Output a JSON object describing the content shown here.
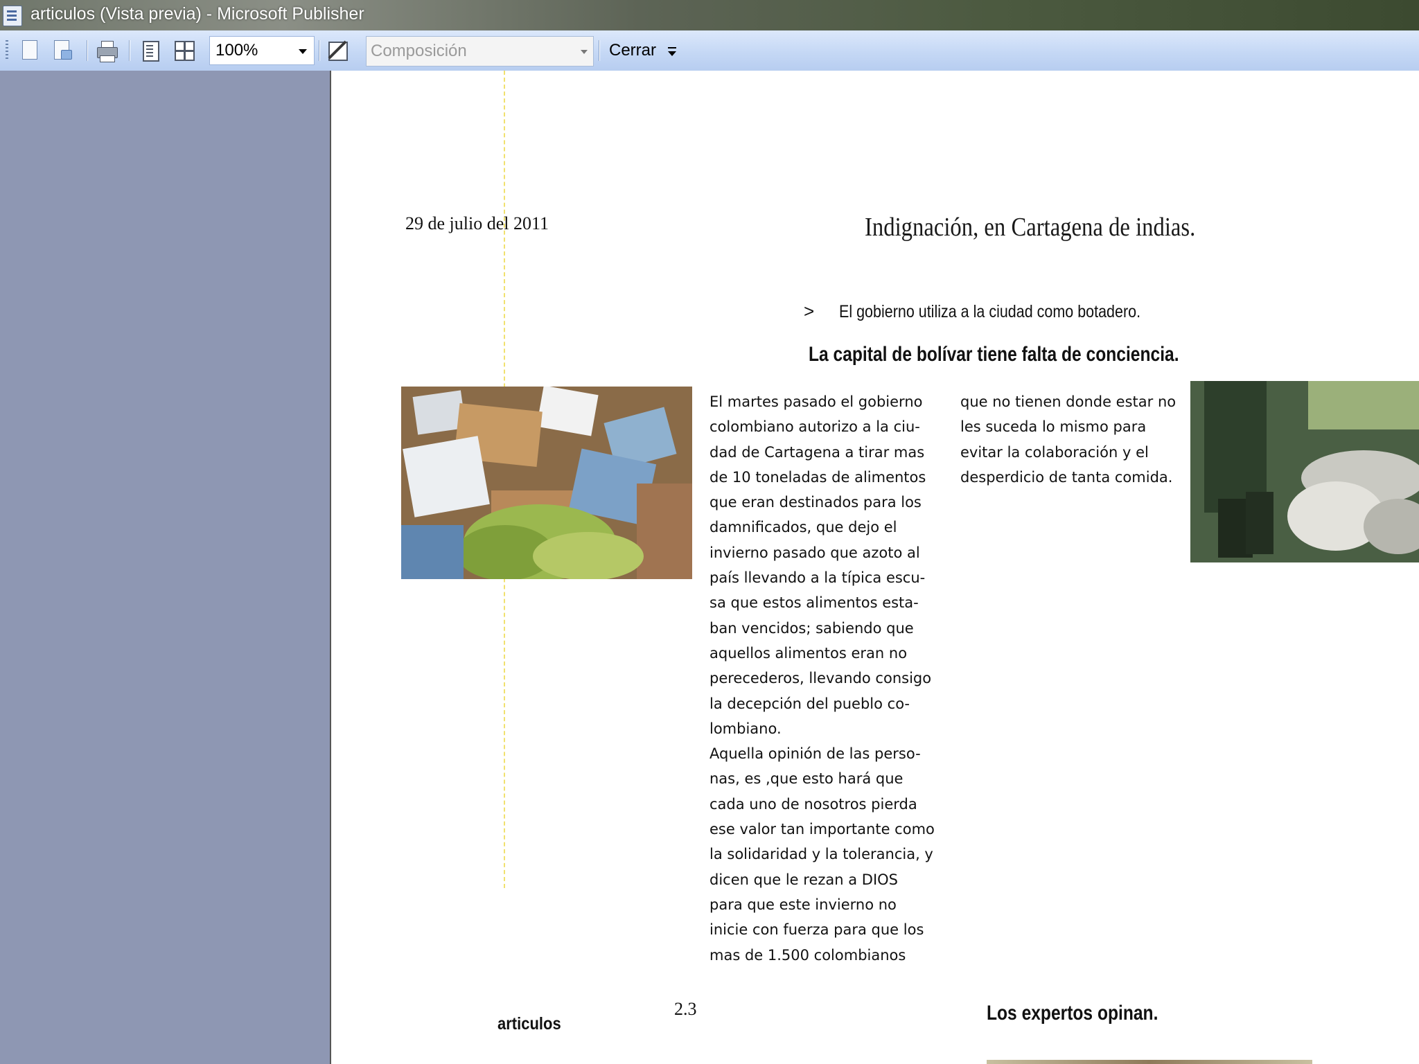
{
  "window": {
    "title": "articulos (Vista previa)  - Microsoft Publisher",
    "icon": "publisher-icon"
  },
  "toolbar": {
    "icons": [
      "page-setup-icon",
      "print-preview-icon",
      "print-icon",
      "one-page-icon",
      "multiple-pages-icon",
      "pen-icon"
    ],
    "zoom": "100%",
    "composition_placeholder": "Composición",
    "close_label": "Cerrar"
  },
  "document": {
    "date": "29 de julio del 2011",
    "headline": "Indignación, en Cartagena de indias.",
    "bullet_symbol": ">",
    "bullet_text": "El gobierno utiliza a la ciudad como botadero.",
    "subheadline": "La  capital de bolívar tiene falta de conciencia.",
    "column1_lines": [
      "El martes pasado el gobierno",
      "colombiano autorizo a la ciu-",
      "dad de Cartagena a tirar mas",
      "de 10 toneladas de alimentos",
      "que eran destinados para los",
      "damnificados, que dejo el",
      "invierno pasado que azoto al",
      "país llevando a la típica escu-",
      "sa que estos alimentos esta-",
      "ban vencidos; sabiendo que",
      "aquellos alimentos eran no",
      "perecederos, llevando consigo",
      "la decepción del pueblo co-",
      "lombiano.",
      "Aquella opinión de las perso-",
      "nas, es ,que esto hará que",
      "cada uno de nosotros pierda",
      "ese valor tan importante como",
      "la solidaridad y la tolerancia, y",
      "dicen que le rezan a DIOS",
      "para que este invierno no",
      "inicie con fuerza para que los",
      "mas de 1.500 colombianos"
    ],
    "column2_lines": [
      "que no tienen donde estar no",
      "les suceda lo mismo para",
      "evitar la colaboración y el",
      "desperdicio de tanta comida."
    ],
    "page_number": "2.3",
    "footer_label": "articulos",
    "section_heading": "Los expertos opinan."
  },
  "colors": {
    "toolbar": "#c5d8f5",
    "side_panel": "#8e97b3",
    "guide_line": "#f1e16e"
  }
}
